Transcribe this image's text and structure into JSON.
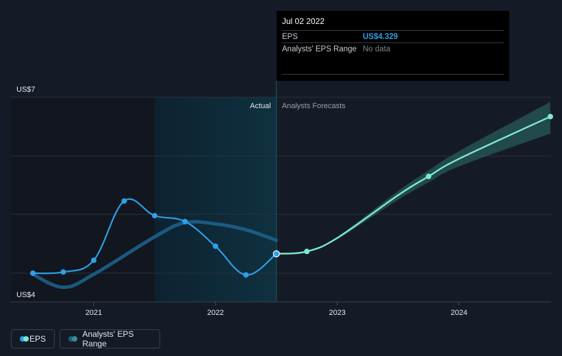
{
  "colors": {
    "background": "#151b26",
    "eps_actual": "#2e9fe8",
    "eps_forecast": "#7ee8d6",
    "range_actual": "#1e5f8a",
    "range_forecast": "#3a8f87",
    "forecast_band": "#2e6f6a",
    "highlight": "#0f3140"
  },
  "tooltip": {
    "date": "Jul 02 2022",
    "eps_label": "EPS",
    "eps_value": "US$4.329",
    "range_label": "Analysts' EPS Range",
    "range_value": "No data"
  },
  "section_labels": {
    "actual": "Actual",
    "forecast": "Analysts Forecasts"
  },
  "legend": {
    "eps_label": "EPS",
    "range_label": "Analysts' EPS Range"
  },
  "chart_data": {
    "type": "line",
    "y_axis": {
      "min": 4.0,
      "max": 7.0,
      "top_label": "US$7",
      "bottom_label": "US$4",
      "gridlines": [
        4.0,
        5.0,
        6.0,
        7.0
      ]
    },
    "x_axis": {
      "min": 2020.5,
      "max": 2024.75,
      "tick_labels": [
        "2021",
        "2022",
        "2023",
        "2024"
      ],
      "ticks": [
        2021.0,
        2022.0,
        2023.0,
        2024.0
      ]
    },
    "highlight_start": 2021.5,
    "divider": 2022.5,
    "series": [
      {
        "role": "eps_actual",
        "points": [
          [
            2020.5,
            4.0
          ],
          [
            2020.75,
            4.02
          ],
          [
            2021.0,
            4.22
          ],
          [
            2021.25,
            5.23
          ],
          [
            2021.5,
            4.98
          ],
          [
            2021.75,
            4.88
          ],
          [
            2022.0,
            4.46
          ],
          [
            2022.25,
            3.97
          ],
          [
            2022.5,
            4.33
          ]
        ]
      },
      {
        "role": "range_actual",
        "points": [
          [
            2020.5,
            3.98
          ],
          [
            2020.75,
            3.76
          ],
          [
            2021.0,
            3.98
          ],
          [
            2021.5,
            4.62
          ],
          [
            2021.75,
            4.86
          ],
          [
            2022.0,
            4.84
          ],
          [
            2022.25,
            4.74
          ],
          [
            2022.5,
            4.56
          ]
        ]
      },
      {
        "role": "eps_forecast",
        "points": [
          [
            2022.5,
            4.33
          ],
          [
            2022.75,
            4.37
          ],
          [
            2023.0,
            4.6
          ],
          [
            2023.5,
            5.33
          ],
          [
            2023.75,
            5.65
          ],
          [
            2024.0,
            5.95
          ],
          [
            2024.75,
            6.67
          ]
        ]
      },
      {
        "role": "range_forecast_band",
        "upper": [
          [
            2022.5,
            4.33
          ],
          [
            2022.75,
            4.37
          ],
          [
            2023.0,
            4.62
          ],
          [
            2023.5,
            5.4
          ],
          [
            2023.75,
            5.75
          ],
          [
            2024.0,
            6.08
          ],
          [
            2024.75,
            6.92
          ]
        ],
        "lower": [
          [
            2022.5,
            4.33
          ],
          [
            2022.75,
            4.37
          ],
          [
            2023.0,
            4.58
          ],
          [
            2023.5,
            5.25
          ],
          [
            2023.75,
            5.55
          ],
          [
            2024.0,
            5.82
          ],
          [
            2024.75,
            6.38
          ]
        ]
      }
    ],
    "marker_points": [
      {
        "series": "eps_actual",
        "x": 2020.5,
        "y": 4.0
      },
      {
        "series": "eps_actual",
        "x": 2020.75,
        "y": 4.02
      },
      {
        "series": "eps_actual",
        "x": 2021.0,
        "y": 4.22
      },
      {
        "series": "eps_actual",
        "x": 2021.25,
        "y": 5.23
      },
      {
        "series": "eps_actual",
        "x": 2021.5,
        "y": 4.98
      },
      {
        "series": "eps_actual",
        "x": 2021.75,
        "y": 4.88
      },
      {
        "series": "eps_actual",
        "x": 2022.0,
        "y": 4.46
      },
      {
        "series": "eps_actual",
        "x": 2022.25,
        "y": 3.97
      },
      {
        "series": "eps_actual",
        "x": 2022.5,
        "y": 4.33
      },
      {
        "series": "eps_forecast",
        "x": 2022.75,
        "y": 4.37
      },
      {
        "series": "eps_forecast",
        "x": 2023.75,
        "y": 5.65
      },
      {
        "series": "eps_forecast",
        "x": 2024.75,
        "y": 6.67
      }
    ]
  }
}
